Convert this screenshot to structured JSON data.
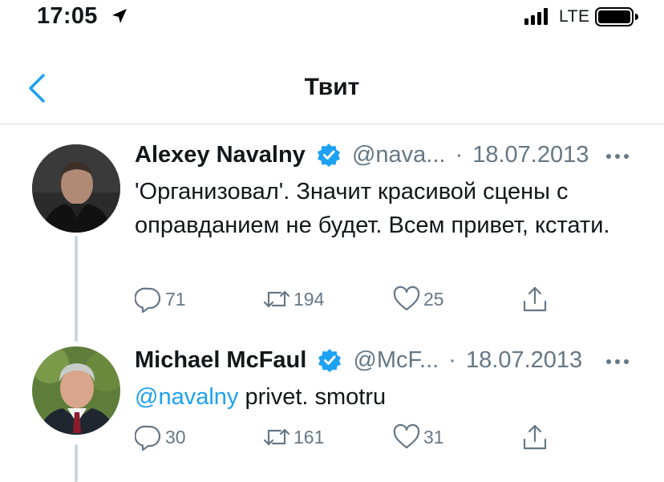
{
  "status_bar": {
    "time": "17:05",
    "network": "LTE"
  },
  "nav": {
    "title": "Твит"
  },
  "tweets": [
    {
      "author": "Alexey Navalny",
      "handle": "@nava...",
      "dot": "·",
      "date": "18.07.2013",
      "text": "'Организовал'. Значит красивой сцены с оправданием не будет. Всем привет, кстати.",
      "replies": "71",
      "retweets": "194",
      "likes": "25"
    },
    {
      "author": "Michael McFaul",
      "handle": "@McF...",
      "dot": "·",
      "date": "18.07.2013",
      "mention": "@navalny",
      "text": " privet. smotru",
      "replies": "30",
      "retweets": "161",
      "likes": "31"
    }
  ],
  "colors": {
    "accent": "#1da1f2",
    "secondary_text": "#657786",
    "thread_line": "#cdd6dd"
  },
  "icons": [
    "location-arrow-icon",
    "signal-icon",
    "battery-icon",
    "back-chevron-icon",
    "verified-icon",
    "more-icon",
    "reply-icon",
    "retweet-icon",
    "like-icon",
    "share-icon"
  ]
}
